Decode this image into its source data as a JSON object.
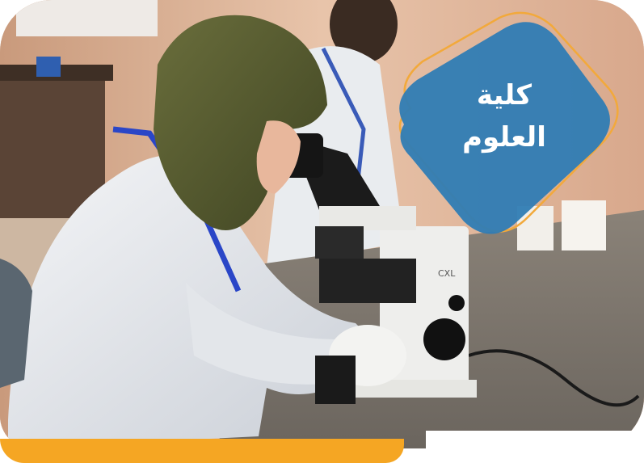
{
  "badge": {
    "line1": "كلية",
    "line2": "العلوم",
    "fill_color": "#2f7cb4",
    "outline_color": "#f2a93b"
  },
  "accent_color": "#f5a623",
  "photo": {
    "description_icon": "lab-microscope-photo",
    "microscope_label": "CXL"
  }
}
